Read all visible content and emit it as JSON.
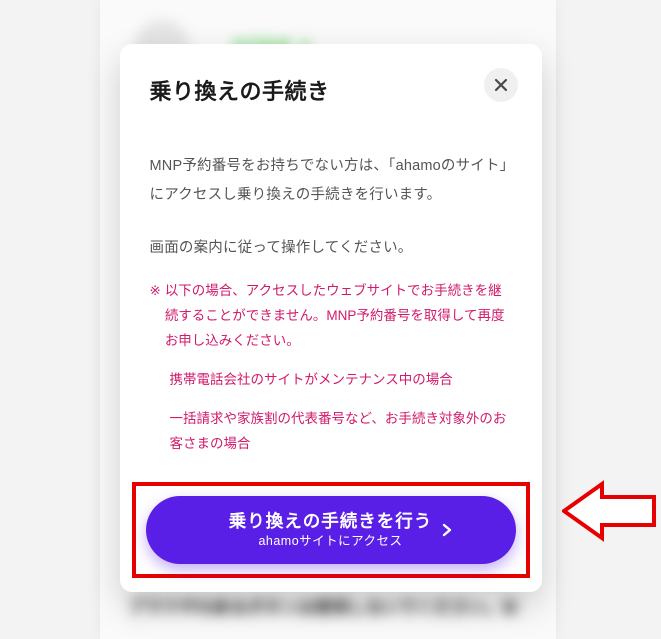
{
  "background": {
    "step_label": "STEP 1",
    "bottom_text": "ブラウザの戻るボタンは使用しないでください。お申"
  },
  "modal": {
    "title": "乗り換えの手続き",
    "paragraph1": "MNP予約番号をお持ちでない方は、「ahamoのサイト」にアクセスし乗り換えの手続きを行います。",
    "paragraph2": "画面の案内に従って操作してください。",
    "note_mark": "※",
    "note_main": "以下の場合、アクセスしたウェブサイトでお手続きを継続することができません。MNP予約番号を取得して再度お申し込みください。",
    "note_sub1": "携帯電話会社のサイトがメンテナンス中の場合",
    "note_sub2": "一括請求や家族割の代表番号など、お手続き対象外のお客さまの場合",
    "cta_main": "乗り換えの手続きを行う",
    "cta_sub": "ahamoサイトにアクセス"
  },
  "colors": {
    "accent_purple": "#5a1fe6",
    "warn_pink": "#d11a6b",
    "callout_red": "#e60000"
  }
}
